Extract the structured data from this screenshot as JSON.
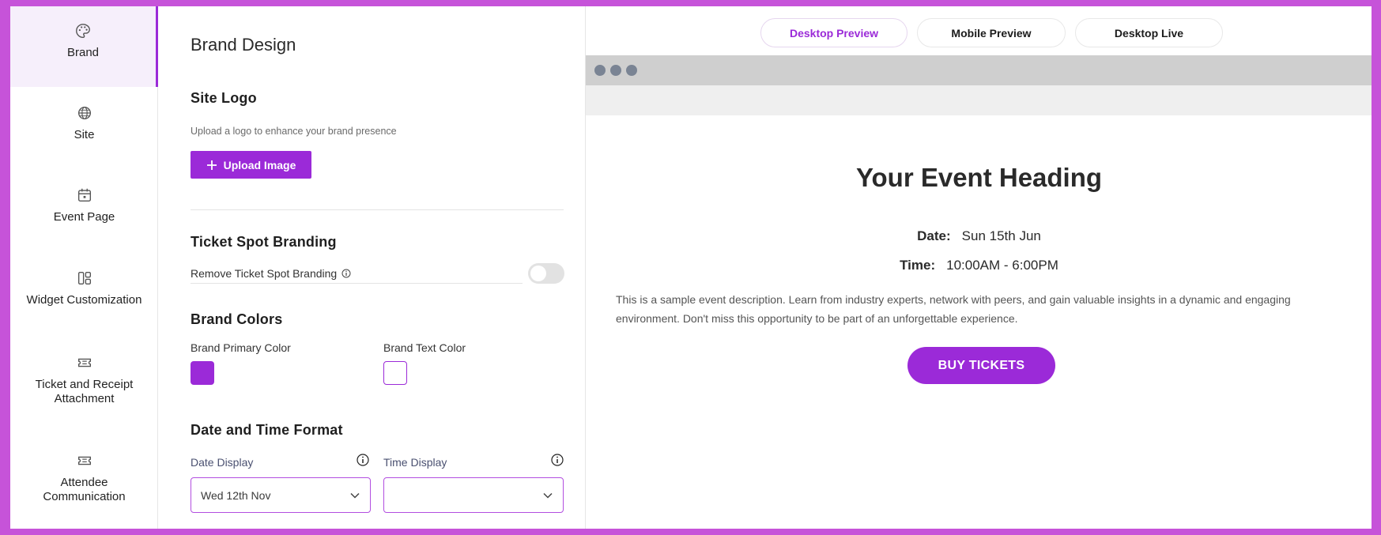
{
  "sidebar": {
    "items": [
      {
        "label": "Brand",
        "icon": "palette-icon"
      },
      {
        "label": "Site",
        "icon": "globe-icon"
      },
      {
        "label": "Event Page",
        "icon": "calendar-icon"
      },
      {
        "label": "Widget Customization",
        "icon": "layout-icon"
      },
      {
        "label": "Ticket and Receipt Attachment",
        "icon": "ticket-icon"
      },
      {
        "label": "Attendee Communication",
        "icon": "ticket-icon"
      }
    ],
    "active": "Brand"
  },
  "panel": {
    "title": "Brand Design",
    "site_logo": {
      "heading": "Site Logo",
      "help": "Upload a logo to enhance your brand presence",
      "upload_label": "Upload Image"
    },
    "branding": {
      "heading": "Ticket Spot Branding",
      "toggle_label": "Remove Ticket Spot Branding",
      "toggle_on": false
    },
    "colors": {
      "heading": "Brand Colors",
      "primary_label": "Brand Primary Color",
      "primary_value": "#9b2ad8",
      "text_label": "Brand Text Color",
      "text_value": "#ffffff"
    },
    "datetime": {
      "heading": "Date and Time Format",
      "date_label": "Date Display",
      "date_value": "Wed 12th Nov",
      "time_label": "Time Display",
      "time_value": ""
    }
  },
  "preview": {
    "tabs": [
      {
        "label": "Desktop Preview",
        "active": true
      },
      {
        "label": "Mobile Preview",
        "active": false
      },
      {
        "label": "Desktop Live",
        "active": false
      }
    ],
    "event": {
      "heading": "Your Event Heading",
      "date_label": "Date:",
      "date_value": "Sun 15th Jun",
      "time_label": "Time:",
      "time_value": "10:00AM - 6:00PM",
      "description": "This is a sample event description. Learn from industry experts, network with peers, and gain valuable insights in a dynamic and engaging environment. Don't miss this opportunity to be part of an unforgettable experience.",
      "button_label": "BUY TICKETS"
    }
  },
  "colors": {
    "accent": "#9b2ad8",
    "frame": "#c653d9"
  }
}
